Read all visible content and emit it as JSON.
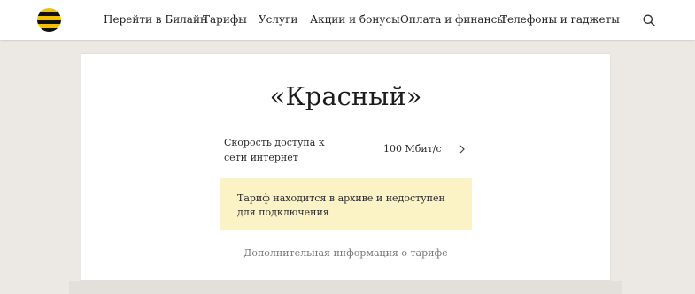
{
  "header": {
    "logo_icon": "beeline-logo-icon",
    "nav": [
      "Перейти в Билайн",
      "Тарифы",
      "Услуги",
      "Акции и бонусы",
      "Оплата и финансы",
      "Телефоны и гаджеты"
    ],
    "search_icon": "search-icon"
  },
  "tariff": {
    "title": "«Красный»",
    "params": [
      {
        "label": "Скорость доступа к сети интернет",
        "value": "100 Мбит/с"
      }
    ],
    "notice": "Тариф находится в архиве и недоступен для подключения",
    "more_link": "Дополнительная информация о тарифе"
  },
  "colors": {
    "brand_yellow": "#f2c200",
    "brand_black": "#111111",
    "notice_bg": "#fbf2c5",
    "page_bg": "#ece9e4"
  }
}
